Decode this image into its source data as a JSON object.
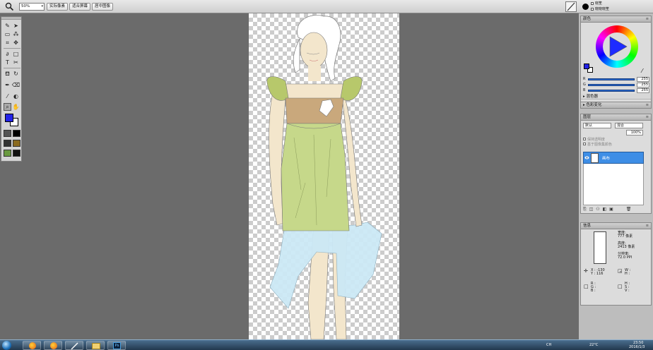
{
  "toolbar": {
    "zoom_value": "50%",
    "actual_pixels": "实际像素",
    "fit_screen": "适合屏幕",
    "center_image": "居中图像",
    "right_label_1": "晓笙",
    "right_label_2": "晓晓晓笙"
  },
  "color_panel": {
    "title": "颜色",
    "r_label": "R",
    "r_value": "255",
    "g_label": "G",
    "g_value": "255",
    "b_label": "B",
    "b_value": "255",
    "mixer": "混色器",
    "color_variation": "色彩变化"
  },
  "layers_panel": {
    "title": "图层",
    "blend_mode": "默认",
    "composite": "混合",
    "opacity": "100%",
    "opt1": "保持透明度",
    "opt2": "基于图像集颜色",
    "layer_name": "画布"
  },
  "info_panel": {
    "title": "信息",
    "width_label": "宽度:",
    "width_value": "777 像素",
    "height_label": "高度:",
    "height_value": "2413 像素",
    "resolution_label": "分辨率:",
    "resolution_value": "72.0 PPI",
    "x_readout": "X : -130",
    "y_readout": "Y : 116",
    "w_label": "W :",
    "h_label": "H :",
    "r_label": "R :",
    "g_label": "G :",
    "b_label": "B :",
    "h2_label": "H :",
    "s_label": "S :",
    "v_label": "V :"
  },
  "taskbar": {
    "lang": "CH",
    "temp": "22°C",
    "clock_time": "23:50",
    "clock_date": "2016/1/3",
    "ps_label": "Ps"
  },
  "icons": [
    "zoom-icon",
    "brush-icon",
    "paintbucket-icon",
    "eyedropper-icon",
    "hand-icon",
    "eye-icon",
    "windows-orb-icon"
  ]
}
